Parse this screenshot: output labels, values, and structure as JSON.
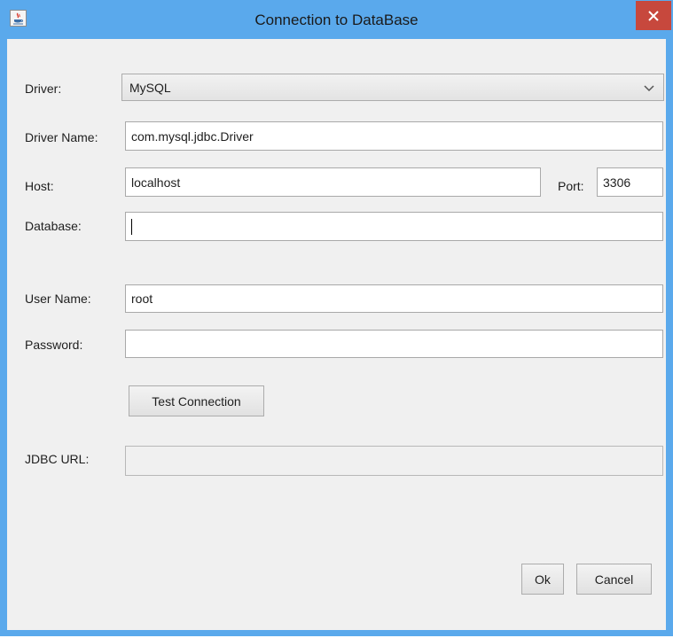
{
  "window": {
    "title": "Connection to DataBase",
    "icon": "java-cup-icon",
    "close_icon": "close-icon"
  },
  "form": {
    "driver_label": "Driver:",
    "driver_value": "MySQL",
    "driver_name_label": "Driver Name:",
    "driver_name_value": "com.mysql.jdbc.Driver",
    "host_label": "Host:",
    "host_value": "localhost",
    "port_label": "Port:",
    "port_value": "3306",
    "database_label": "Database:",
    "database_value": "",
    "user_name_label": "User Name:",
    "user_name_value": "root",
    "password_label": "Password:",
    "password_value": "",
    "test_connection_label": "Test Connection",
    "jdbc_url_label": "JDBC URL:",
    "jdbc_url_value": ""
  },
  "buttons": {
    "ok_label": "Ok",
    "cancel_label": "Cancel"
  },
  "colors": {
    "titlebar": "#5aa9ec",
    "close_button": "#c7483d",
    "panel_background": "#f0f0f0"
  }
}
